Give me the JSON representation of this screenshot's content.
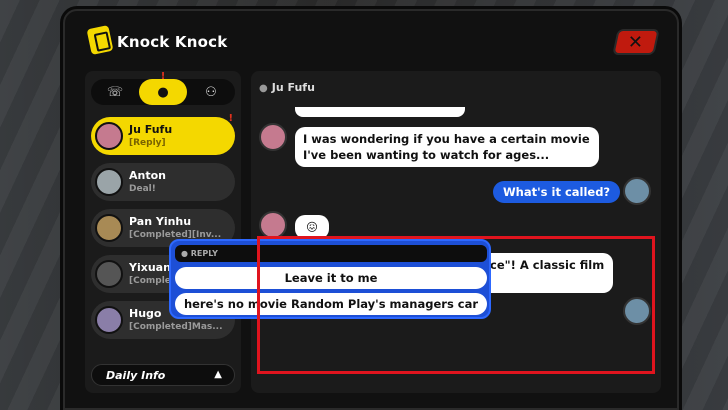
{
  "app": {
    "title": "Knock Knock"
  },
  "close_icon": "close-icon",
  "tabs": [
    {
      "icon": "phone-icon"
    },
    {
      "icon": "contact-icon",
      "badge": "!"
    },
    {
      "icon": "group-icon"
    }
  ],
  "contacts": [
    {
      "name": "Ju Fufu",
      "status": "[Reply]",
      "badge": "!"
    },
    {
      "name": "Anton",
      "status": "Deal!"
    },
    {
      "name": "Pan Yinhu",
      "status": "[Completed][Inv..."
    },
    {
      "name": "Yixuan",
      "status": "[Completed]Sou..."
    },
    {
      "name": "Hugo",
      "status": "[Completed]Mas..."
    }
  ],
  "daily_info": {
    "label": "Daily Info",
    "arrow": "▲"
  },
  "chat": {
    "header": "Ju Fufu",
    "messages": [
      {
        "from": "Ju Fufu",
        "text": "I was wondering if you have a certain movie I've been wanting to watch for ages..."
      },
      {
        "from": "me",
        "text": "What's it called?"
      },
      {
        "from": "Ju Fufu",
        "text": "😖"
      },
      {
        "from": "Ju Fufu",
        "text": "It's \"Tiger Hero, Dragon Justice\"! A classic film from some years back"
      }
    ],
    "reply": {
      "label": "REPLY",
      "options": [
        "Leave it to me",
        "here's no movie Random Play's managers car"
      ]
    }
  },
  "colors": {
    "accent": "#f4d800",
    "reply_blue": "#1d5be0",
    "highlight": "#e0141e"
  }
}
